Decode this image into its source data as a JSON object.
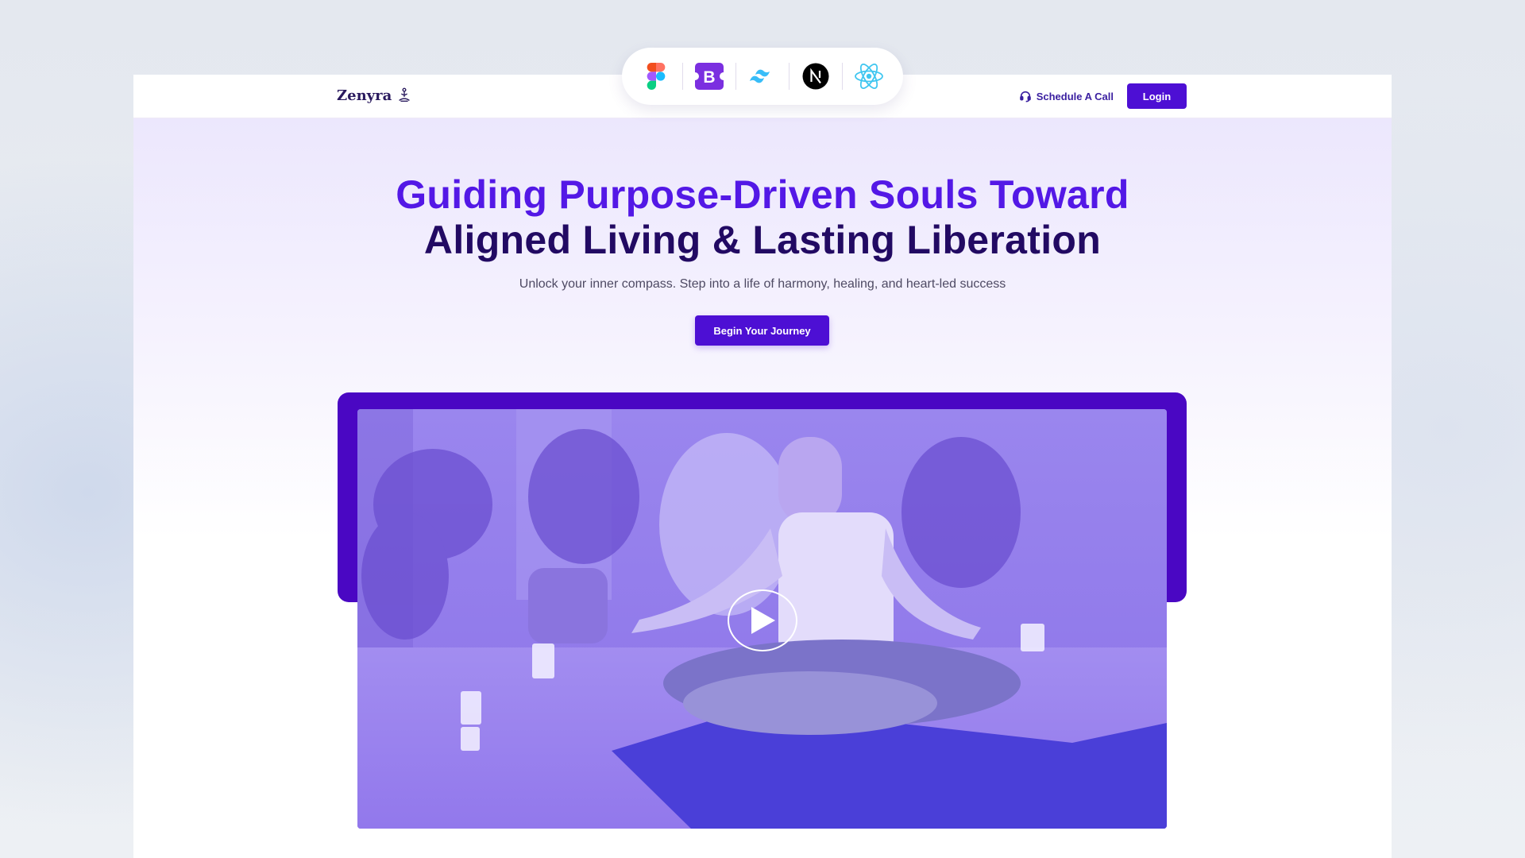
{
  "brand": {
    "name": "Zenyra",
    "icon": "meditation-logo-icon"
  },
  "nav": {
    "schedule_label": "Schedule A Call",
    "schedule_icon": "headset-icon",
    "login_label": "Login"
  },
  "tech_stack": [
    {
      "name": "Figma",
      "icon": "figma-icon"
    },
    {
      "name": "Bootstrap",
      "icon": "bootstrap-icon"
    },
    {
      "name": "Tailwind CSS",
      "icon": "tailwind-icon"
    },
    {
      "name": "Next.js",
      "icon": "nextjs-icon"
    },
    {
      "name": "React",
      "icon": "react-icon"
    }
  ],
  "hero": {
    "headline_line1": "Guiding Purpose-Driven Souls Toward",
    "headline_line2": "Aligned Living & Lasting Liberation",
    "subheadline": "Unlock your inner compass. Step into a life of harmony, healing, and heart-led success",
    "cta_label": "Begin Your Journey"
  },
  "video": {
    "play_icon": "play-icon"
  },
  "colors": {
    "primary": "#4d0fd4",
    "headline_accent": "#5318e6",
    "headline_dark": "#220a63",
    "video_frame": "#4a07c3"
  }
}
